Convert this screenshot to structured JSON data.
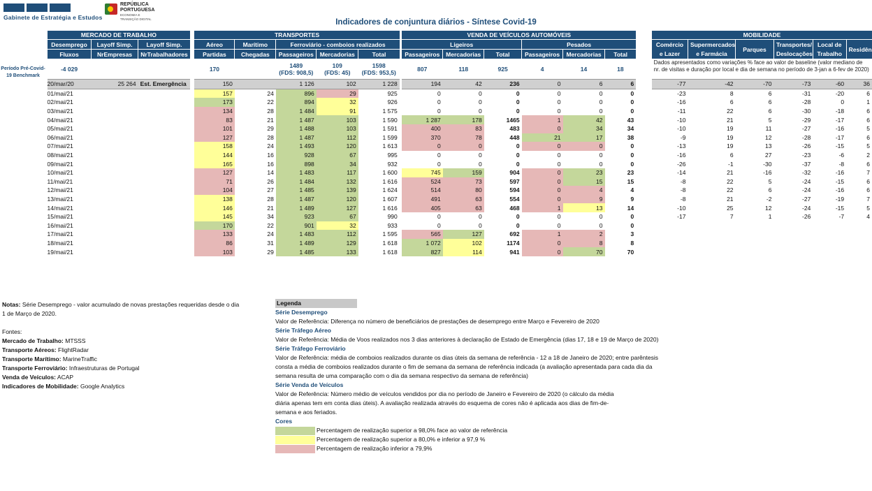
{
  "brand": {
    "gee": "Gabinete de Estratégia e Estudos",
    "rp_line1": "REPÚBLICA",
    "rp_line2": "PORTUGUESA",
    "rp_sub1": "ECONOMIA E",
    "rp_sub2": "TRANSIÇÃO DIGITAL"
  },
  "title": "Indicadores de conjuntura diários - Síntese Covid-19",
  "sections": {
    "labor": "MERCADO DE TRABALHO",
    "transport": "TRANSPORTES",
    "vehicles": "VENDA DE VEÍCULOS AUTOMÓVEIS",
    "mobility": "MOBILIDADE"
  },
  "sub": {
    "desemprego": "Desemprego",
    "layoff1": "Layoff Simp.",
    "layoff2": "Layoff Simp.",
    "aereo": "Aéreo",
    "maritimo": "Marítimo",
    "ferroviario": "Ferroviário - comboios realizados",
    "ligeiros": "Ligeiros",
    "pesados": "Pesados",
    "comercio": "Comércio e Lazer",
    "supermercados": "Supermercados e Farmácia",
    "parques": "Parques",
    "transportes": "Transportes/ Deslocações",
    "local": "Local de Trabalho",
    "residencia": "Residência"
  },
  "cols": {
    "fluxos": "Fluxos",
    "nrempresas": "NrEmpresas",
    "nrtrab": "NrTrabalhadores",
    "partidas": "Partidas",
    "chegadas": "Chegadas",
    "passageiros": "Passageiros",
    "mercadorias": "Mercadorias",
    "total": "Total"
  },
  "benchmark": {
    "label": "Período Pré-Covid-19 Benchmark",
    "fluxos": "-4 029",
    "aereo": "170",
    "ferro_pass": "1489",
    "ferro_pass_fds": "(FDS: 908,5)",
    "ferro_merc": "109",
    "ferro_merc_fds": "(FDS: 45)",
    "ferro_total": "1598",
    "ferro_total_fds": "(FDS: 953,5)",
    "lig_pass": "807",
    "lig_merc": "118",
    "lig_total": "925",
    "pes_pass": "4",
    "pes_merc": "14",
    "pes_total": "18",
    "mob_note": "Dados apresentados como variações % face ao valor de baseline (valor mediano de nr. de visitas e duração por local e dia de semana no período de 3-jan a 6-fev de 2020)"
  },
  "emergency": {
    "date": "20/mar/20",
    "fluxos": "25 264",
    "label": "Est. Emergência",
    "aereo": "150",
    "maritimo": "",
    "fpass": "1 126",
    "fmerc": "102",
    "ftot": "1 228",
    "lpass": "194",
    "lmerc": "42",
    "ltot": "236",
    "ppass": "0",
    "pmerc": "6",
    "ptot": "6",
    "mob": [
      "-77",
      "-42",
      "-70",
      "-73",
      "-60",
      "36"
    ]
  },
  "rows": [
    {
      "date": "01/mai/21",
      "a": "157",
      "ac": "Y",
      "m": "24",
      "fp": "896",
      "fpc": "G",
      "fm": "29",
      "fmc": "R",
      "ft": "925",
      "lp": "0",
      "lpc": "",
      "lm": "0",
      "lmc": "",
      "lt": "0",
      "pp": "0",
      "ppc": "",
      "pm": "0",
      "pmc": "",
      "pt": "0",
      "mob": [
        "-23",
        "8",
        "6",
        "-31",
        "-20",
        "6"
      ]
    },
    {
      "date": "02/mai/21",
      "a": "173",
      "ac": "G",
      "m": "22",
      "fp": "894",
      "fpc": "G",
      "fm": "32",
      "fmc": "Y",
      "ft": "926",
      "lp": "0",
      "lpc": "",
      "lm": "0",
      "lmc": "",
      "lt": "0",
      "pp": "0",
      "ppc": "",
      "pm": "0",
      "pmc": "",
      "pt": "0",
      "mob": [
        "-16",
        "6",
        "6",
        "-28",
        "0",
        "1"
      ]
    },
    {
      "date": "03/mai/21",
      "a": "134",
      "ac": "R",
      "m": "28",
      "fp": "1 484",
      "fpc": "G",
      "fm": "91",
      "fmc": "Y",
      "ft": "1 575",
      "lp": "0",
      "lpc": "",
      "lm": "0",
      "lmc": "",
      "lt": "0",
      "pp": "0",
      "ppc": "",
      "pm": "0",
      "pmc": "",
      "pt": "0",
      "mob": [
        "-11",
        "22",
        "6",
        "-30",
        "-18",
        "6"
      ]
    },
    {
      "date": "04/mai/21",
      "a": "83",
      "ac": "R",
      "m": "21",
      "fp": "1 487",
      "fpc": "G",
      "fm": "103",
      "fmc": "G",
      "ft": "1 590",
      "lp": "1 287",
      "lpc": "G",
      "lm": "178",
      "lmc": "G",
      "lt": "1465",
      "pp": "1",
      "ppc": "R",
      "pm": "42",
      "pmc": "G",
      "pt": "43",
      "mob": [
        "-10",
        "21",
        "5",
        "-29",
        "-17",
        "6"
      ]
    },
    {
      "date": "05/mai/21",
      "a": "101",
      "ac": "R",
      "m": "29",
      "fp": "1 488",
      "fpc": "G",
      "fm": "103",
      "fmc": "G",
      "ft": "1 591",
      "lp": "400",
      "lpc": "R",
      "lm": "83",
      "lmc": "R",
      "lt": "483",
      "pp": "0",
      "ppc": "R",
      "pm": "34",
      "pmc": "G",
      "pt": "34",
      "mob": [
        "-10",
        "19",
        "11",
        "-27",
        "-16",
        "5"
      ]
    },
    {
      "date": "06/mai/21",
      "a": "127",
      "ac": "R",
      "m": "28",
      "fp": "1 487",
      "fpc": "G",
      "fm": "112",
      "fmc": "G",
      "ft": "1 599",
      "lp": "370",
      "lpc": "R",
      "lm": "78",
      "lmc": "R",
      "lt": "448",
      "pp": "21",
      "ppc": "G",
      "pm": "17",
      "pmc": "G",
      "pt": "38",
      "mob": [
        "-9",
        "19",
        "12",
        "-28",
        "-17",
        "6"
      ]
    },
    {
      "date": "07/mai/21",
      "a": "158",
      "ac": "Y",
      "m": "24",
      "fp": "1 493",
      "fpc": "G",
      "fm": "120",
      "fmc": "G",
      "ft": "1 613",
      "lp": "0",
      "lpc": "R",
      "lm": "0",
      "lmc": "R",
      "lt": "0",
      "pp": "0",
      "ppc": "R",
      "pm": "0",
      "pmc": "R",
      "pt": "0",
      "mob": [
        "-13",
        "19",
        "13",
        "-26",
        "-15",
        "5"
      ]
    },
    {
      "date": "08/mai/21",
      "a": "144",
      "ac": "Y",
      "m": "16",
      "fp": "928",
      "fpc": "G",
      "fm": "67",
      "fmc": "G",
      "ft": "995",
      "lp": "0",
      "lpc": "",
      "lm": "0",
      "lmc": "",
      "lt": "0",
      "pp": "0",
      "ppc": "",
      "pm": "0",
      "pmc": "",
      "pt": "0",
      "mob": [
        "-16",
        "6",
        "27",
        "-23",
        "-6",
        "2"
      ]
    },
    {
      "date": "09/mai/21",
      "a": "165",
      "ac": "Y",
      "m": "16",
      "fp": "898",
      "fpc": "G",
      "fm": "34",
      "fmc": "G",
      "ft": "932",
      "lp": "0",
      "lpc": "",
      "lm": "0",
      "lmc": "",
      "lt": "0",
      "pp": "0",
      "ppc": "",
      "pm": "0",
      "pmc": "",
      "pt": "0",
      "mob": [
        "-26",
        "-1",
        "-30",
        "-37",
        "-8",
        "6"
      ]
    },
    {
      "date": "10/mai/21",
      "a": "127",
      "ac": "R",
      "m": "14",
      "fp": "1 483",
      "fpc": "G",
      "fm": "117",
      "fmc": "G",
      "ft": "1 600",
      "lp": "745",
      "lpc": "Y",
      "lm": "159",
      "lmc": "G",
      "lt": "904",
      "pp": "0",
      "ppc": "R",
      "pm": "23",
      "pmc": "G",
      "pt": "23",
      "mob": [
        "-14",
        "21",
        "-16",
        "-32",
        "-16",
        "7"
      ]
    },
    {
      "date": "11/mai/21",
      "a": "71",
      "ac": "R",
      "m": "26",
      "fp": "1 484",
      "fpc": "G",
      "fm": "132",
      "fmc": "G",
      "ft": "1 616",
      "lp": "524",
      "lpc": "R",
      "lm": "73",
      "lmc": "R",
      "lt": "597",
      "pp": "0",
      "ppc": "R",
      "pm": "15",
      "pmc": "G",
      "pt": "15",
      "mob": [
        "-8",
        "22",
        "5",
        "-24",
        "-15",
        "6"
      ]
    },
    {
      "date": "12/mai/21",
      "a": "104",
      "ac": "R",
      "m": "27",
      "fp": "1 485",
      "fpc": "G",
      "fm": "139",
      "fmc": "G",
      "ft": "1 624",
      "lp": "514",
      "lpc": "R",
      "lm": "80",
      "lmc": "R",
      "lt": "594",
      "pp": "0",
      "ppc": "R",
      "pm": "4",
      "pmc": "R",
      "pt": "4",
      "mob": [
        "-8",
        "22",
        "6",
        "-24",
        "-16",
        "6"
      ]
    },
    {
      "date": "13/mai/21",
      "a": "138",
      "ac": "Y",
      "m": "28",
      "fp": "1 487",
      "fpc": "G",
      "fm": "120",
      "fmc": "G",
      "ft": "1 607",
      "lp": "491",
      "lpc": "R",
      "lm": "63",
      "lmc": "R",
      "lt": "554",
      "pp": "0",
      "ppc": "R",
      "pm": "9",
      "pmc": "R",
      "pt": "9",
      "mob": [
        "-8",
        "21",
        "-2",
        "-27",
        "-19",
        "7"
      ]
    },
    {
      "date": "14/mai/21",
      "a": "146",
      "ac": "Y",
      "m": "21",
      "fp": "1 489",
      "fpc": "G",
      "fm": "127",
      "fmc": "G",
      "ft": "1 616",
      "lp": "405",
      "lpc": "R",
      "lm": "63",
      "lmc": "R",
      "lt": "468",
      "pp": "1",
      "ppc": "R",
      "pm": "13",
      "pmc": "Y",
      "pt": "14",
      "mob": [
        "-10",
        "25",
        "12",
        "-24",
        "-15",
        "5"
      ]
    },
    {
      "date": "15/mai/21",
      "a": "145",
      "ac": "Y",
      "m": "34",
      "fp": "923",
      "fpc": "G",
      "fm": "67",
      "fmc": "G",
      "ft": "990",
      "lp": "0",
      "lpc": "",
      "lm": "0",
      "lmc": "",
      "lt": "0",
      "pp": "0",
      "ppc": "",
      "pm": "0",
      "pmc": "",
      "pt": "0",
      "mob": [
        "-17",
        "7",
        "1",
        "-26",
        "-7",
        "4"
      ]
    },
    {
      "date": "16/mai/21",
      "a": "170",
      "ac": "G",
      "m": "22",
      "fp": "901",
      "fpc": "G",
      "fm": "32",
      "fmc": "Y",
      "ft": "933",
      "lp": "0",
      "lpc": "",
      "lm": "0",
      "lmc": "",
      "lt": "0",
      "pp": "0",
      "ppc": "",
      "pm": "0",
      "pmc": "",
      "pt": "0",
      "mob": [
        "",
        "",
        "",
        "",
        "",
        ""
      ]
    },
    {
      "date": "17/mai/21",
      "a": "133",
      "ac": "R",
      "m": "24",
      "fp": "1 483",
      "fpc": "G",
      "fm": "112",
      "fmc": "G",
      "ft": "1 595",
      "lp": "565",
      "lpc": "R",
      "lm": "127",
      "lmc": "G",
      "lt": "692",
      "pp": "1",
      "ppc": "R",
      "pm": "2",
      "pmc": "R",
      "pt": "3",
      "mob": [
        "",
        "",
        "",
        "",
        "",
        ""
      ]
    },
    {
      "date": "18/mai/21",
      "a": "86",
      "ac": "R",
      "m": "31",
      "fp": "1 489",
      "fpc": "G",
      "fm": "129",
      "fmc": "G",
      "ft": "1 618",
      "lp": "1 072",
      "lpc": "G",
      "lm": "102",
      "lmc": "Y",
      "lt": "1174",
      "pp": "0",
      "ppc": "R",
      "pm": "8",
      "pmc": "R",
      "pt": "8",
      "mob": [
        "",
        "",
        "",
        "",
        "",
        ""
      ]
    },
    {
      "date": "19/mai/21",
      "a": "103",
      "ac": "R",
      "m": "29",
      "fp": "1 485",
      "fpc": "G",
      "fm": "133",
      "fmc": "G",
      "ft": "1 618",
      "lp": "827",
      "lpc": "G",
      "lm": "114",
      "lmc": "Y",
      "lt": "941",
      "pp": "0",
      "ppc": "R",
      "pm": "70",
      "pmc": "G",
      "pt": "70",
      "mob": [
        "",
        "",
        "",
        "",
        "",
        ""
      ]
    }
  ],
  "notes": {
    "label": "Notas:",
    "text": "Série Desemprego - valor acumulado de novas prestações requeridas desde o dia 1 de Março de 2020.",
    "fontes": "Fontes:",
    "sources": [
      {
        "k": "Mercado de Trabalho:",
        "v": "MTSSS"
      },
      {
        "k": "Transporte Aéreos:",
        "v": "FlightRadar"
      },
      {
        "k": "Transporte Marítimo:",
        "v": "MarineTraffic"
      },
      {
        "k": "Transporte Ferroviário:",
        "v": "Infraestruturas de Portugal"
      },
      {
        "k": "Venda de Veículos:",
        "v": "ACAP"
      },
      {
        "k": "Indicadores de Mobilidade:",
        "v": "Google Analytics"
      }
    ]
  },
  "legend": {
    "header": "Legenda",
    "s1": "Série Desemprego",
    "s1t": "Valor de Referência: Diferença no número de beneficiários de prestações de desemprego entre Março e Fevereiro de 2020",
    "s2": "Série Tráfego Aéreo",
    "s2t": "Valor de Referência: Média de Voos realizados nos 3 dias anteriores à declaração de Estado de Emergência (dias 17, 18 e 19 de Março de 2020)",
    "s3": "Série Tráfego Ferroviário",
    "s3t": "Valor de Referência: média de comboios realizados durante os dias úteis da semana de referência - 12 a 18 de Janeiro de 2020; entre parêntesis consta a média de comboios realizados durante o fim de semana da semana de referência indicada (a avaliação apresentada para cada dia da semana resulta de uma comparação com o dia da semana respectivo da semana de referência)",
    "s4": "Série Venda de Veículos",
    "s4t": "Valor de Referência: Número médio de veículos vendidos por dia no período de Janeiro e Fevereiro de 2020 (o cálculo da média diária apenas tem em conta dias úteis). A avaliação realizada através do esquema de cores não é aplicada aos dias de fim-de-semana e aos feriados.",
    "cores": "Cores",
    "c1": "Percentagem de realização superior a 98,0% face ao valor de referência",
    "c2": "Percentagem de realização superior a 80,0% e inferior a 97,9 %",
    "c3": "Percentagem de realização inferior a 79,9%",
    "colors": {
      "green": "#c4d79b",
      "yellow": "#ffff99",
      "red": "#e6b8b7",
      "header": "#1f4e79"
    }
  }
}
